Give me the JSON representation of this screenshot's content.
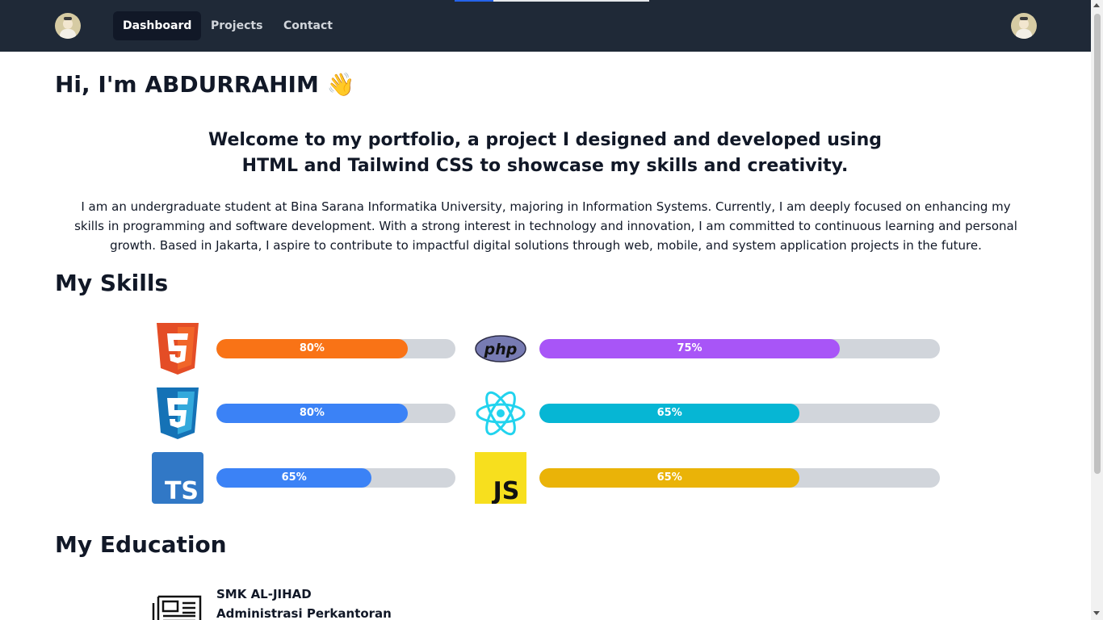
{
  "nav": {
    "links": [
      {
        "label": "Dashboard",
        "active": true
      },
      {
        "label": "Projects",
        "active": false
      },
      {
        "label": "Contact",
        "active": false
      }
    ]
  },
  "hero": {
    "greeting": "Hi, I'm ABDURRAHIM",
    "wave_emoji": "👋",
    "welcome_line1": "Welcome to my portfolio, a project I designed and developed using",
    "welcome_line2": "HTML and Tailwind CSS to showcase my skills and creativity.",
    "about": "I am an undergraduate student at Bina Sarana Informatika University, majoring in Information Systems. Currently, I am deeply focused on enhancing my skills in programming and software development. With a strong interest in technology and innovation, I am committed to continuous learning and personal growth. Based in Jakarta, I aspire to contribute to impactful digital solutions through web, mobile, and system application projects in the future."
  },
  "skills": {
    "title": "My Skills",
    "items": [
      {
        "icon": "html5-icon",
        "label": "80%",
        "value": 80,
        "color": "#f97316"
      },
      {
        "icon": "php-icon",
        "label": "75%",
        "value": 75,
        "color": "#a855f7"
      },
      {
        "icon": "css3-icon",
        "label": "80%",
        "value": 80,
        "color": "#3b82f6"
      },
      {
        "icon": "react-icon",
        "label": "65%",
        "value": 65,
        "color": "#06b6d4"
      },
      {
        "icon": "typescript-icon",
        "label": "65%",
        "value": 65,
        "color": "#3b82f6"
      },
      {
        "icon": "javascript-icon",
        "label": "65%",
        "value": 65,
        "color": "#eab308"
      }
    ]
  },
  "education": {
    "title": "My Education",
    "school": "SMK AL-JIHAD",
    "major": "Administrasi Perkantoran"
  },
  "colors": {
    "navbar": "#1f2937",
    "active_link": "#111827",
    "track": "#d1d5db"
  }
}
